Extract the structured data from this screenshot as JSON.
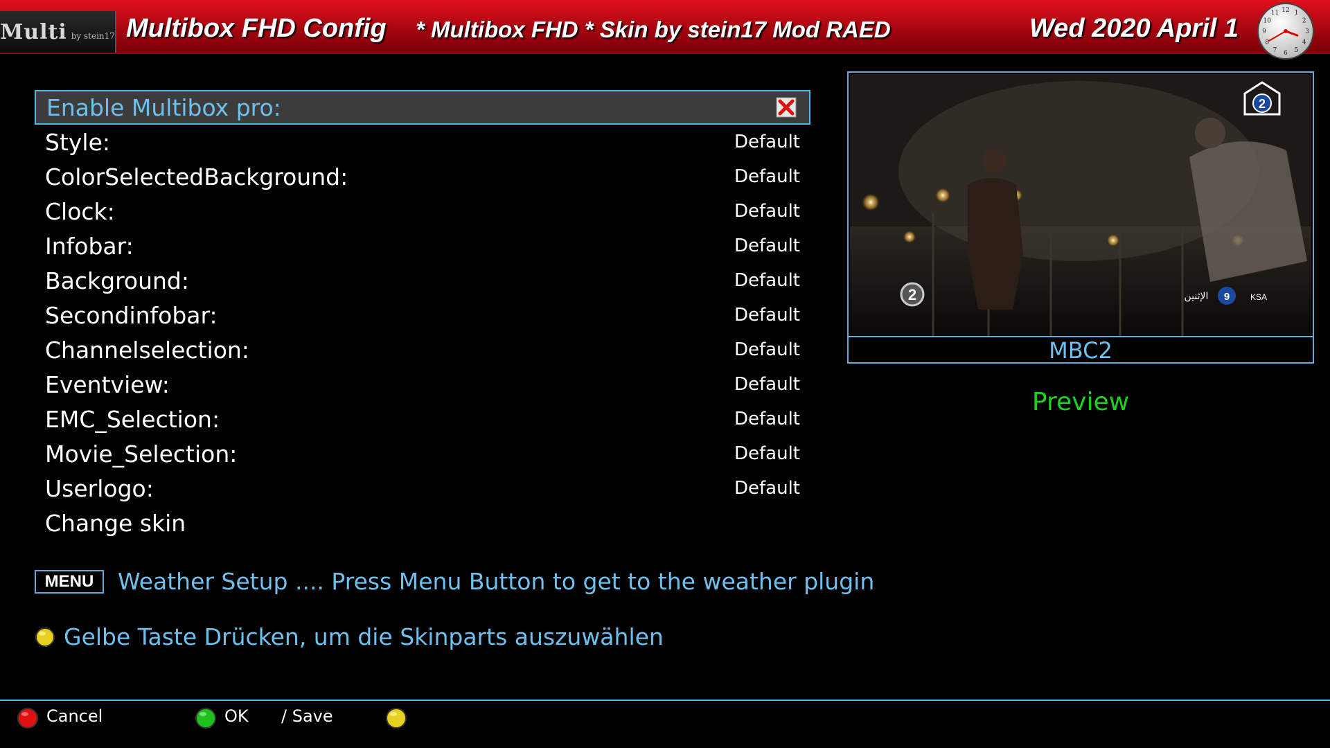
{
  "header": {
    "logo_main": "Multi",
    "logo_sub": "by stein17",
    "title": "Multibox FHD Config",
    "subtitle": "* Multibox FHD * Skin by stein17 Mod RAED",
    "date": "Wed 2020 April 1",
    "clock_hour": 3,
    "clock_minute": 40
  },
  "settings": [
    {
      "label": "Enable Multibox pro:",
      "value": "",
      "selected": true,
      "checkbox": "x-icon"
    },
    {
      "label": "Style:",
      "value": "Default"
    },
    {
      "label": "ColorSelectedBackground:",
      "value": "Default"
    },
    {
      "label": "Clock:",
      "value": "Default"
    },
    {
      "label": "Infobar:",
      "value": "Default"
    },
    {
      "label": "Background:",
      "value": "Default"
    },
    {
      "label": "Secondinfobar:",
      "value": "Default"
    },
    {
      "label": "Channelselection:",
      "value": "Default"
    },
    {
      "label": "Eventview:",
      "value": "Default"
    },
    {
      "label": "EMC_Selection:",
      "value": "Default"
    },
    {
      "label": "Movie_Selection:",
      "value": "Default"
    },
    {
      "label": "Userlogo:",
      "value": "Default"
    },
    {
      "label": "Change skin",
      "value": ""
    }
  ],
  "preview": {
    "channel": "MBC2",
    "label": "Preview",
    "badge_number": "2",
    "overlay_number": "9",
    "overlay_arabic": "الإثنين",
    "overlay_region": "KSA"
  },
  "hints": {
    "menu_key": "MENU",
    "menu_text": "Weather Setup .... Press Menu Button to get to the weather plugin",
    "yellow_text": "Gelbe Taste Drücken, um die Skinparts auszuwählen"
  },
  "footer": {
    "red_label": "Cancel",
    "green_label": "OK",
    "save_label": "/ Save",
    "yellow_label": ""
  },
  "colors": {
    "accent_blue": "#6ec0ee",
    "header_red": "#c00812",
    "preview_green": "#1ed11e",
    "red_button": "#e01010",
    "green_button": "#1ec01e",
    "yellow_button": "#e8d020"
  }
}
